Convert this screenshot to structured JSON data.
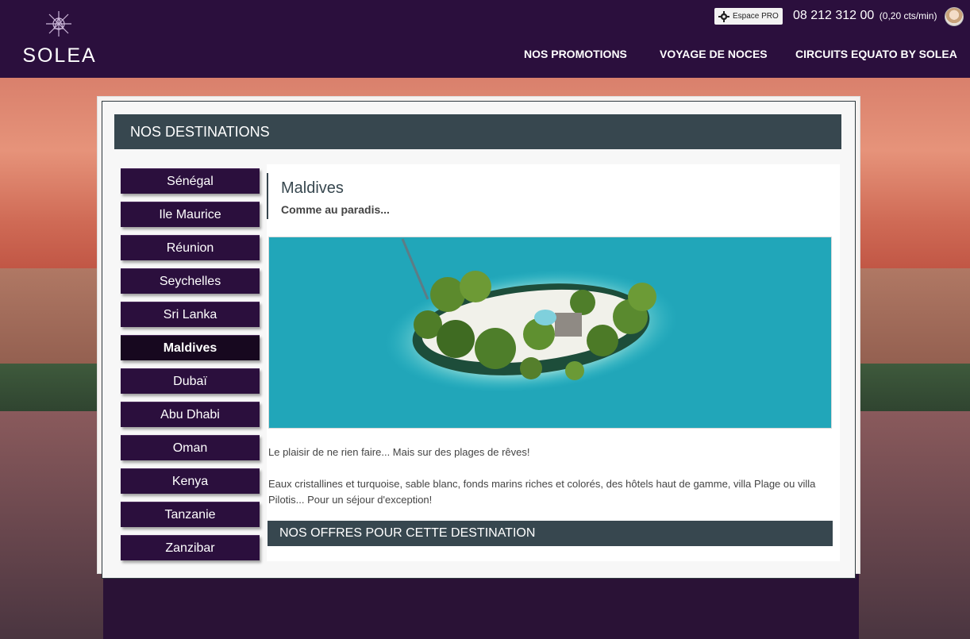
{
  "brand": {
    "name": "SOLEA"
  },
  "topbar": {
    "pro_label": "Espace PRO",
    "phone": "08 212 312 00",
    "phone_rate": "(0,20 cts/min)"
  },
  "nav": {
    "promotions": "NOS PROMOTIONS",
    "noces": "VOYAGE DE NOCES",
    "circuits": "CIRCUITS EQUATO BY SOLEA"
  },
  "section": {
    "title": "NOS DESTINATIONS"
  },
  "destinations": [
    "Sénégal",
    "Ile Maurice",
    "Réunion",
    "Seychelles",
    "Sri Lanka",
    "Maldives",
    "Dubaï",
    "Abu Dhabi",
    "Oman",
    "Kenya",
    "Tanzanie",
    "Zanzibar"
  ],
  "active_destination": "Maldives",
  "detail": {
    "title": "Maldives",
    "subtitle": "Comme au paradis...",
    "paragraph1": "Le plaisir de ne rien faire... Mais sur des plages de rêves!",
    "paragraph2": "Eaux cristallines et turquoise, sable blanc, fonds marins riches et colorés, des hôtels haut de gamme, villa Plage ou villa Pilotis... Pour un séjour d'exception!",
    "offers_title": "NOS OFFRES POUR CETTE DESTINATION"
  },
  "icons": {
    "settings": "gear-icon",
    "logo": "star-logo-icon",
    "user": "avatar"
  },
  "colors": {
    "header": "#2b0f3d",
    "section_bar": "#37474f",
    "menu_item": "#2b0f3d",
    "menu_active": "#17081f"
  }
}
